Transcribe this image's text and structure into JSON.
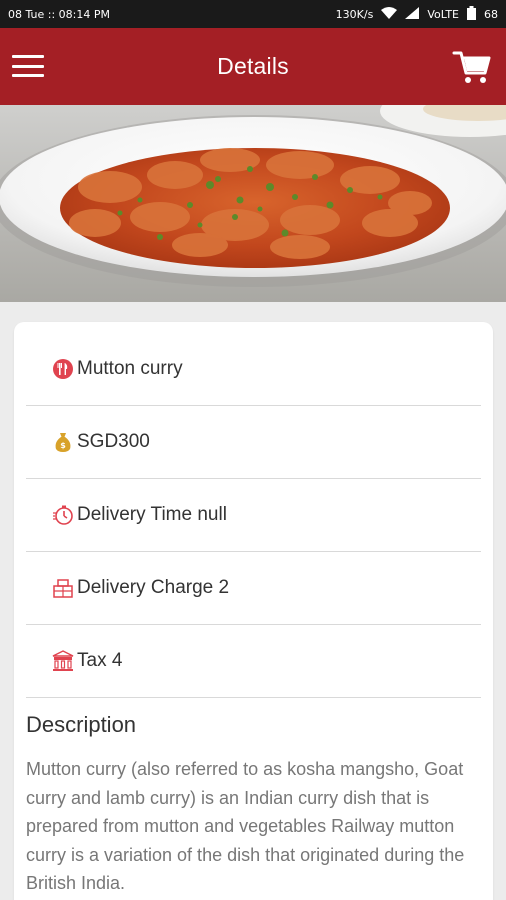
{
  "status_bar": {
    "time": "08 Tue :: 08:14 PM",
    "net_speed": "130K/s",
    "network": "VoLTE",
    "battery": "68"
  },
  "app_bar": {
    "title": "Details"
  },
  "details": {
    "name": "Mutton curry",
    "price": "SGD300",
    "delivery_time": "Delivery Time null",
    "delivery_charge": "Delivery Charge 2",
    "tax": "Tax 4"
  },
  "description": {
    "title": "Description",
    "text": "Mutton curry (also referred to as kosha mangsho, Goat curry and lamb curry) is an Indian curry dish that is prepared from mutton and vegetables Railway mutton curry is a variation of the dish that originated during the British India."
  },
  "colors": {
    "primary": "#a41f25",
    "icon_red": "#e0434f",
    "icon_gold": "#d8a22a"
  }
}
